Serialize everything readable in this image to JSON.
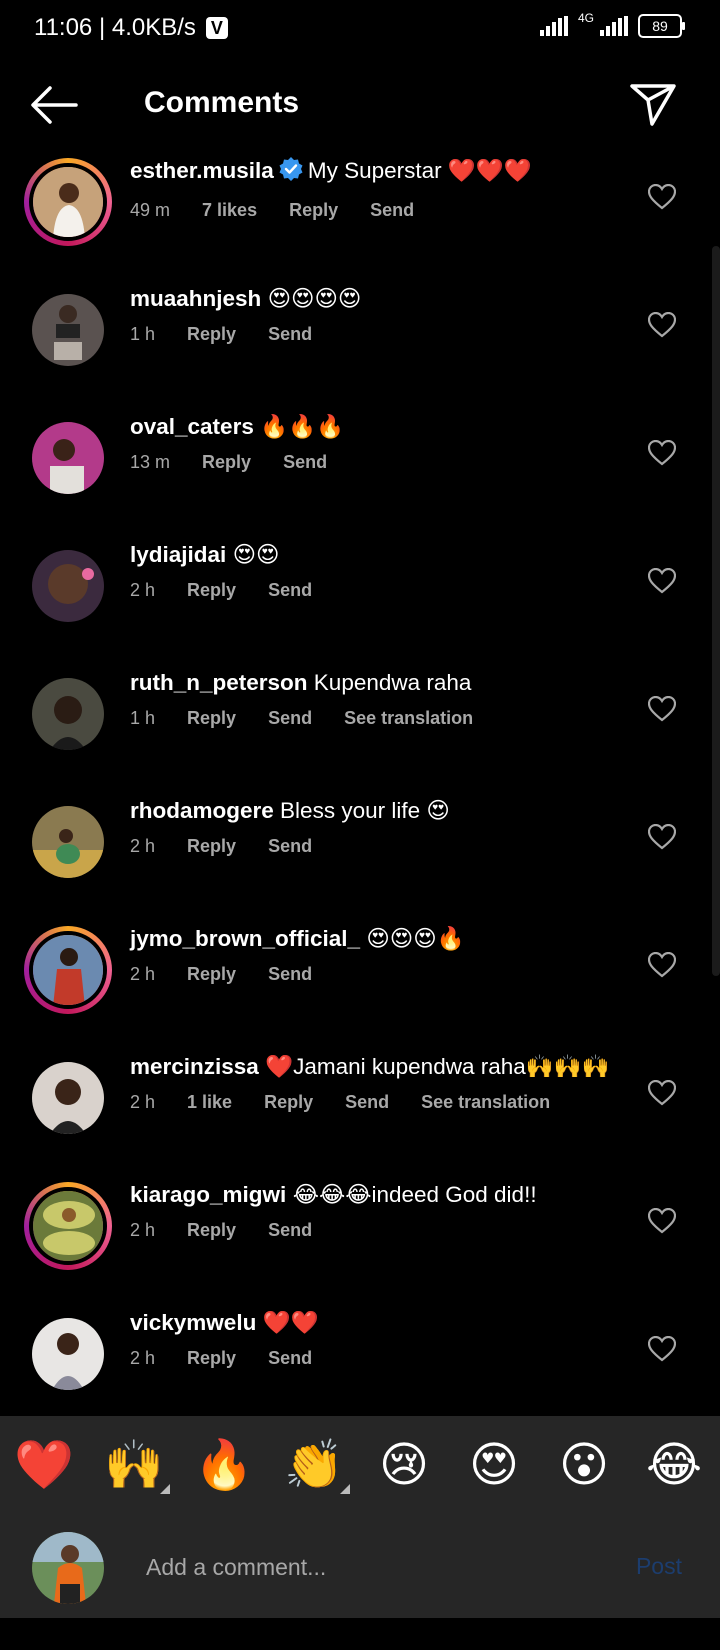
{
  "status_bar": {
    "time_speed": "11:06 | 4.0KB/s",
    "carrier_badge": "V",
    "network": "4G",
    "battery": "89"
  },
  "header": {
    "title": "Comments",
    "back_icon": "arrow-left-icon",
    "send_icon": "paper-plane-icon"
  },
  "comments": [
    {
      "username": "esther.musila",
      "verified": true,
      "text": "My Superstar ❤️❤️❤️",
      "time": "49 m",
      "likes": "7 likes",
      "reply": "Reply",
      "send": "Send",
      "translation": "",
      "story": true
    },
    {
      "username": "muaahnjesh",
      "verified": false,
      "text": "😍😍😍😍",
      "time": "1 h",
      "likes": "",
      "reply": "Reply",
      "send": "Send",
      "translation": "",
      "story": false
    },
    {
      "username": "oval_caters",
      "verified": false,
      "text": "🔥🔥🔥",
      "time": "13 m",
      "likes": "",
      "reply": "Reply",
      "send": "Send",
      "translation": "",
      "story": false
    },
    {
      "username": "lydiajidai",
      "verified": false,
      "text": "😍😍",
      "time": "2 h",
      "likes": "",
      "reply": "Reply",
      "send": "Send",
      "translation": "",
      "story": false
    },
    {
      "username": "ruth_n_peterson",
      "verified": false,
      "text": "Kupendwa raha",
      "time": "1 h",
      "likes": "",
      "reply": "Reply",
      "send": "Send",
      "translation": "See translation",
      "story": false
    },
    {
      "username": "rhodamogere",
      "verified": false,
      "text": "Bless your life 😍",
      "time": "2 h",
      "likes": "",
      "reply": "Reply",
      "send": "Send",
      "translation": "",
      "story": false
    },
    {
      "username": "jymo_brown_official_",
      "verified": false,
      "text": "😍😍😍🔥",
      "time": "2 h",
      "likes": "",
      "reply": "Reply",
      "send": "Send",
      "translation": "",
      "story": true
    },
    {
      "username": "mercinzissa",
      "verified": false,
      "text": "❤️Jamani kupendwa raha🙌🙌🙌",
      "time": "2 h",
      "likes": "1 like",
      "reply": "Reply",
      "send": "Send",
      "translation": "See translation",
      "story": false
    },
    {
      "username": "kiarago_migwi",
      "verified": false,
      "text": "😂😂😂indeed God did!!",
      "time": "2 h",
      "likes": "",
      "reply": "Reply",
      "send": "Send",
      "translation": "",
      "story": true
    },
    {
      "username": "vickymwelu",
      "verified": false,
      "text": "❤️❤️",
      "time": "2 h",
      "likes": "",
      "reply": "Reply",
      "send": "Send",
      "translation": "",
      "story": false
    }
  ],
  "emoji_bar": [
    "❤️",
    "🙌",
    "🔥",
    "👏",
    "😢",
    "😍",
    "😮",
    "😂"
  ],
  "input_bar": {
    "placeholder": "Add a comment...",
    "post_label": "Post"
  },
  "colors": {
    "background": "#000000",
    "panel": "#262626",
    "secondary_text": "#a8a8a8",
    "post_disabled": "#1c3d6e",
    "verified_blue": "#3897f0"
  }
}
